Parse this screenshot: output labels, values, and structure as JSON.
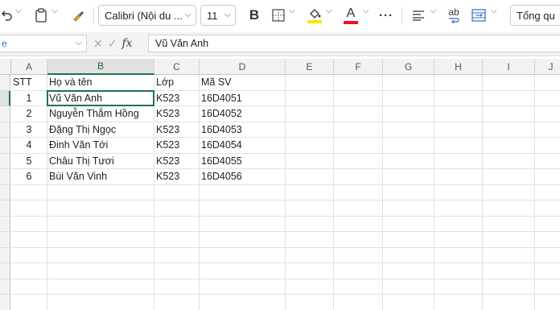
{
  "toolbar": {
    "font_name": "Calibri (Nội du ...",
    "font_size": "11",
    "bold_label": "B",
    "font_color_label": "A",
    "more_label": "···",
    "wrap_label": "ab",
    "autosum_label": "Tổng qu",
    "highlight_color": "#ffe600",
    "font_color": "#e81123"
  },
  "formula_bar": {
    "name_box": "e",
    "cancel_symbol": "✕",
    "enter_symbol": "✓",
    "fx_label": "fx",
    "content": "Vũ Văn Anh"
  },
  "columns": [
    "A",
    "B",
    "C",
    "D",
    "E",
    "F",
    "G",
    "H",
    "I",
    "J"
  ],
  "active_column": "B",
  "row_labels": [
    "",
    "",
    "",
    "",
    "",
    "",
    "",
    "",
    "",
    "",
    "",
    "",
    "",
    "",
    "",
    ""
  ],
  "table": {
    "headers": [
      "STT",
      "Họ và tên",
      "Lớp",
      "Mã SV"
    ],
    "rows": [
      [
        "1",
        "Vũ Văn Anh",
        "K523",
        "16D4051"
      ],
      [
        "2",
        "Nguyễn Thắm Hồng",
        "K523",
        "16D4052"
      ],
      [
        "3",
        "Đặng Thị Ngọc",
        "K523",
        "16D4053"
      ],
      [
        "4",
        "Đinh Văn Tới",
        "K523",
        "16D4054"
      ],
      [
        "5",
        "Châu Thị Tươi",
        "K523",
        "16D4055"
      ],
      [
        "6",
        "Bùi Văn Vinh",
        "K523",
        "16D4056"
      ]
    ]
  },
  "colors": {
    "accent": "#217346"
  }
}
